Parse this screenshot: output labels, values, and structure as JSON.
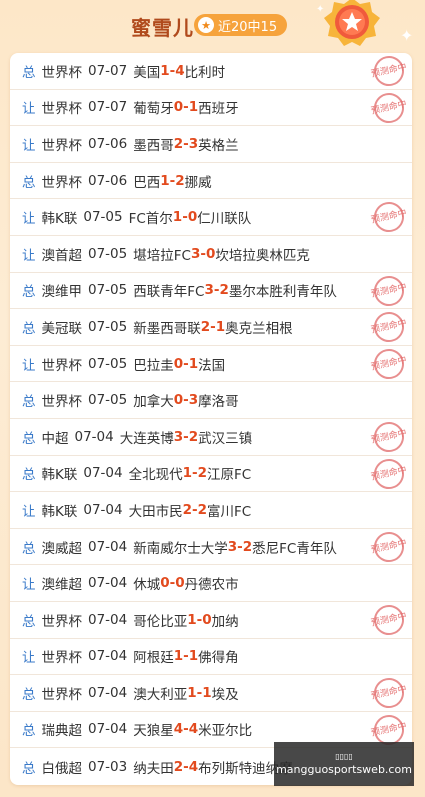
{
  "header": {
    "title": "蜜雪儿",
    "badge": "近20中15"
  },
  "stamp_text": "预测命中",
  "watermark": {
    "top": "▯▯▯▯",
    "site": "mangguosportsweb.com"
  },
  "rows": [
    {
      "type": "总",
      "league": "世界杯",
      "date": "07-07",
      "home": "美国",
      "s1": "1",
      "s2": "4",
      "away": "比利时",
      "hit": true
    },
    {
      "type": "让",
      "league": "世界杯",
      "date": "07-07",
      "home": "葡萄牙",
      "s1": "0",
      "s2": "1",
      "away": "西班牙",
      "hit": true
    },
    {
      "type": "让",
      "league": "世界杯",
      "date": "07-06",
      "home": "墨西哥",
      "s1": "2",
      "s2": "3",
      "away": "英格兰",
      "hit": false
    },
    {
      "type": "总",
      "league": "世界杯",
      "date": "07-06",
      "home": "巴西",
      "s1": "1",
      "s2": "2",
      "away": "挪威",
      "hit": false
    },
    {
      "type": "让",
      "league": "韩K联",
      "date": "07-05",
      "home": "FC首尔",
      "s1": "1",
      "s2": "0",
      "away": "仁川联队",
      "hit": true
    },
    {
      "type": "让",
      "league": "澳首超",
      "date": "07-05",
      "home": "堪培拉FC",
      "s1": "3",
      "s2": "0",
      "away": "坎培拉奥林匹克",
      "hit": false
    },
    {
      "type": "总",
      "league": "澳维甲",
      "date": "07-05",
      "home": "西联青年FC",
      "s1": "3",
      "s2": "2",
      "away": "墨尔本胜利青年队",
      "hit": true
    },
    {
      "type": "总",
      "league": "美冠联",
      "date": "07-05",
      "home": "新墨西哥联",
      "s1": "2",
      "s2": "1",
      "away": "奥克兰相根",
      "hit": true
    },
    {
      "type": "让",
      "league": "世界杯",
      "date": "07-05",
      "home": "巴拉圭",
      "s1": "0",
      "s2": "1",
      "away": "法国",
      "hit": true
    },
    {
      "type": "总",
      "league": "世界杯",
      "date": "07-05",
      "home": "加拿大",
      "s1": "0",
      "s2": "3",
      "away": "摩洛哥",
      "hit": false
    },
    {
      "type": "总",
      "league": "中超",
      "date": "07-04",
      "home": "大连英博",
      "s1": "3",
      "s2": "2",
      "away": "武汉三镇",
      "hit": true
    },
    {
      "type": "总",
      "league": "韩K联",
      "date": "07-04",
      "home": "全北现代",
      "s1": "1",
      "s2": "2",
      "away": "江原FC",
      "hit": true
    },
    {
      "type": "让",
      "league": "韩K联",
      "date": "07-04",
      "home": "大田市民",
      "s1": "2",
      "s2": "2",
      "away": "富川FC",
      "hit": false
    },
    {
      "type": "总",
      "league": "澳威超",
      "date": "07-04",
      "home": "新南威尔士大学",
      "s1": "3",
      "s2": "2",
      "away": "悉尼FC青年队",
      "hit": true
    },
    {
      "type": "让",
      "league": "澳维超",
      "date": "07-04",
      "home": "休城",
      "s1": "0",
      "s2": "0",
      "away": "丹德农市",
      "hit": false
    },
    {
      "type": "总",
      "league": "世界杯",
      "date": "07-04",
      "home": "哥伦比亚",
      "s1": "1",
      "s2": "0",
      "away": "加纳",
      "hit": true
    },
    {
      "type": "让",
      "league": "世界杯",
      "date": "07-04",
      "home": "阿根廷",
      "s1": "1",
      "s2": "1",
      "away": "佛得角",
      "hit": false
    },
    {
      "type": "总",
      "league": "世界杯",
      "date": "07-04",
      "home": "澳大利亚",
      "s1": "1",
      "s2": "1",
      "away": "埃及",
      "hit": true
    },
    {
      "type": "总",
      "league": "瑞典超",
      "date": "07-04",
      "home": "天狼星",
      "s1": "4",
      "s2": "4",
      "away": "米亚尔比",
      "hit": true
    },
    {
      "type": "总",
      "league": "白俄超",
      "date": "07-03",
      "home": "纳夫田",
      "s1": "2",
      "s2": "4",
      "away": "布列斯特迪纳摩",
      "hit": false
    }
  ]
}
